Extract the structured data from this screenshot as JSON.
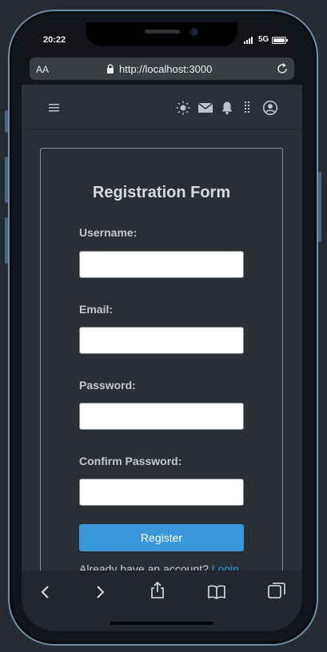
{
  "status_bar": {
    "time": "20:22",
    "network": "5G"
  },
  "browser": {
    "text_size_label": "AA",
    "url": "http://localhost:3000"
  },
  "nav": {
    "icons": [
      "menu-icon",
      "sun-icon",
      "mail-icon",
      "bell-icon",
      "apps-icon",
      "account-icon"
    ]
  },
  "form": {
    "title": "Registration Form",
    "fields": [
      {
        "label": "Username:",
        "value": "",
        "placeholder": ""
      },
      {
        "label": "Email:",
        "value": "",
        "placeholder": ""
      },
      {
        "label": "Password:",
        "value": "",
        "placeholder": ""
      },
      {
        "label": "Confirm Password:",
        "value": "",
        "placeholder": ""
      }
    ],
    "submit_label": "Register",
    "login_prompt": "Already have an account?",
    "login_link": "Login"
  },
  "toolbar": {
    "icons": [
      "back-icon",
      "forward-icon",
      "share-icon",
      "bookmarks-icon",
      "tabs-icon"
    ]
  },
  "colors": {
    "accent": "#3a97d9",
    "page_background": "#2a2e35",
    "nav_background": "#2b3038",
    "text": "#dadada"
  }
}
